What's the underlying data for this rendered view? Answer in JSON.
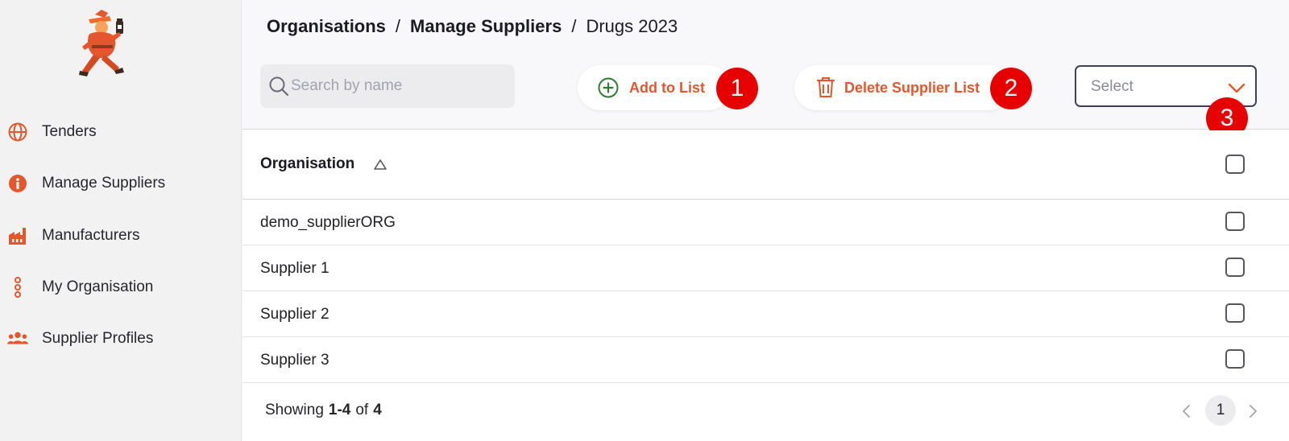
{
  "colors": {
    "accent": "#e4572e",
    "add_icon": "#2e7d32",
    "badge": "#e60000",
    "select_border": "#3d3f5c",
    "sidebar_bg": "#f2f2f3"
  },
  "sidebar": {
    "logo_icon": "runner-mascot-logo",
    "items": [
      {
        "label": "Tenders",
        "icon": "globe-icon"
      },
      {
        "label": "Manage Suppliers",
        "icon": "info-icon"
      },
      {
        "label": "Manufacturers",
        "icon": "factory-icon"
      },
      {
        "label": "My Organisation",
        "icon": "dots-vertical-icon"
      },
      {
        "label": "Supplier Profiles",
        "icon": "users-icon"
      }
    ]
  },
  "breadcrumb": {
    "items": [
      "Organisations",
      "Manage Suppliers"
    ],
    "separator": "/",
    "current": "Drugs 2023"
  },
  "toolbar": {
    "search_placeholder": "Search by name",
    "add_label": "Add to List",
    "delete_label": "Delete Supplier List",
    "select_value": "Select"
  },
  "badges": [
    "1",
    "2",
    "3"
  ],
  "table": {
    "column_header": "Organisation",
    "sort": "ascending",
    "rows": [
      {
        "name": "demo_supplierORG",
        "checked": false
      },
      {
        "name": "Supplier 1",
        "checked": false
      },
      {
        "name": "Supplier 2",
        "checked": false
      },
      {
        "name": "Supplier 3",
        "checked": false
      }
    ]
  },
  "pagination": {
    "showing_prefix": "Showing",
    "range": "1-4",
    "of_word": "of",
    "total": "4",
    "current_page": "1"
  }
}
